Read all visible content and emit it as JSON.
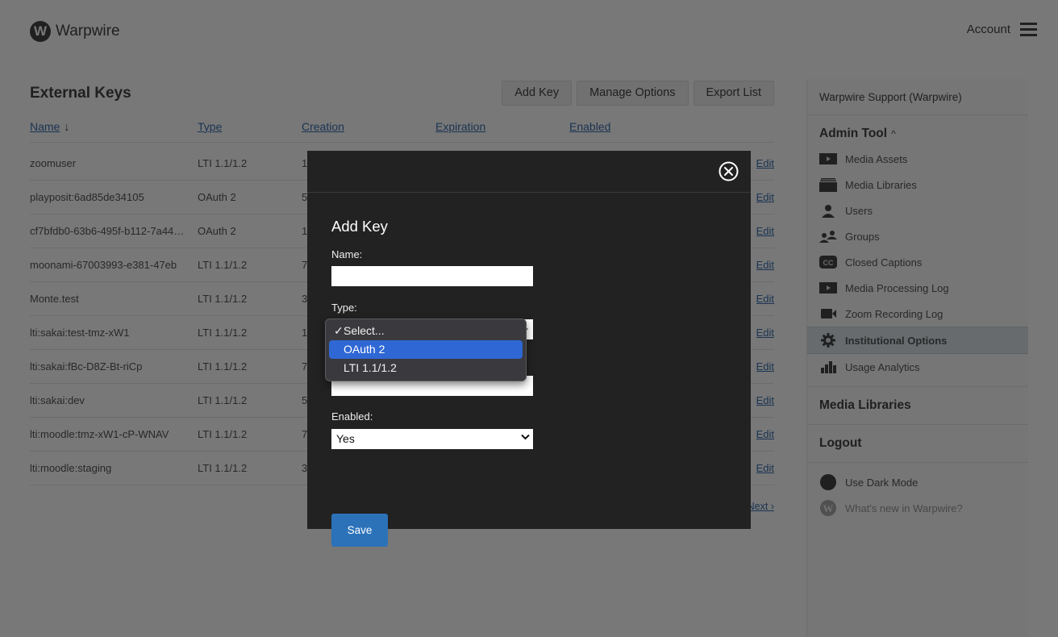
{
  "header": {
    "logo_letter": "W",
    "brand": "Warpwire",
    "account_label": "Account"
  },
  "main": {
    "title": "External Keys",
    "toolbar": {
      "add_key": "Add Key",
      "manage_options": "Manage Options",
      "export_list": "Export List"
    },
    "columns": {
      "name": "Name",
      "sort_indicator": "↓",
      "type": "Type",
      "creation": "Creation",
      "expiration": "Expiration",
      "enabled": "Enabled"
    },
    "rows": [
      {
        "name": "zoomuser",
        "type": "LTI 1.1/1.2",
        "creation_partial": "1",
        "edit": "Edit"
      },
      {
        "name": "playposit:6ad85de34105",
        "type": "OAuth 2",
        "creation_partial": "5",
        "edit": "Edit"
      },
      {
        "name": "cf7bfdb0-63b6-495f-b112-7a44…",
        "type": "OAuth 2",
        "creation_partial": "1",
        "edit": "Edit"
      },
      {
        "name": "moonami-67003993-e381-47eb",
        "type": "LTI 1.1/1.2",
        "creation_partial": "7",
        "edit": "Edit"
      },
      {
        "name": "Monte.test",
        "type": "LTI 1.1/1.2",
        "creation_partial": "3",
        "edit": "Edit"
      },
      {
        "name": "lti:sakai:test-tmz-xW1",
        "type": "LTI 1.1/1.2",
        "creation_partial": "1",
        "edit": "Edit"
      },
      {
        "name": "lti:sakai:fBc-D8Z-Bt-riCp",
        "type": "LTI 1.1/1.2",
        "creation_partial": "7",
        "edit": "Edit"
      },
      {
        "name": "lti:sakai:dev",
        "type": "LTI 1.1/1.2",
        "creation_partial": "5",
        "edit": "Edit"
      },
      {
        "name": "lti:moodle:tmz-xW1-cP-WNAV",
        "type": "LTI 1.1/1.2",
        "creation_partial": "7",
        "edit": "Edit"
      },
      {
        "name": "lti:moodle:staging",
        "type": "LTI 1.1/1.2",
        "creation_partial": "3",
        "edit": "Edit"
      }
    ],
    "pagination_next": "Next ›"
  },
  "sidebar": {
    "user": "Warpwire Support (Warpwire)",
    "admin_title": "Admin Tool",
    "admin_caret": "^",
    "items": [
      {
        "label": "Media Assets",
        "icon": "play-icon"
      },
      {
        "label": "Media Libraries",
        "icon": "library-icon"
      },
      {
        "label": "Users",
        "icon": "user-icon"
      },
      {
        "label": "Groups",
        "icon": "groups-icon"
      },
      {
        "label": "Closed Captions",
        "icon": "cc-icon"
      },
      {
        "label": "Media Processing Log",
        "icon": "play-icon"
      },
      {
        "label": "Zoom Recording Log",
        "icon": "video-camera-icon"
      },
      {
        "label": "Institutional Options",
        "icon": "gear-icon",
        "active": true
      },
      {
        "label": "Usage Analytics",
        "icon": "bar-chart-icon"
      }
    ],
    "media_libraries": "Media Libraries",
    "logout": "Logout",
    "dark_mode": "Use Dark Mode",
    "whats_new": "What's new in Warpwire?",
    "whats_new_letter": "W"
  },
  "modal": {
    "title": "Add Key",
    "name_label": "Name:",
    "name_value": "",
    "type_label": "Type:",
    "type_value": "Select...",
    "type_options": [
      {
        "label": "Select...",
        "checked": true
      },
      {
        "label": "OAuth 2",
        "highlighted": true
      },
      {
        "label": "LTI 1.1/1.2"
      }
    ],
    "check_glyph": "✓",
    "third_field_value": "",
    "enabled_label": "Enabled:",
    "enabled_value": "Yes",
    "save_label": "Save"
  }
}
